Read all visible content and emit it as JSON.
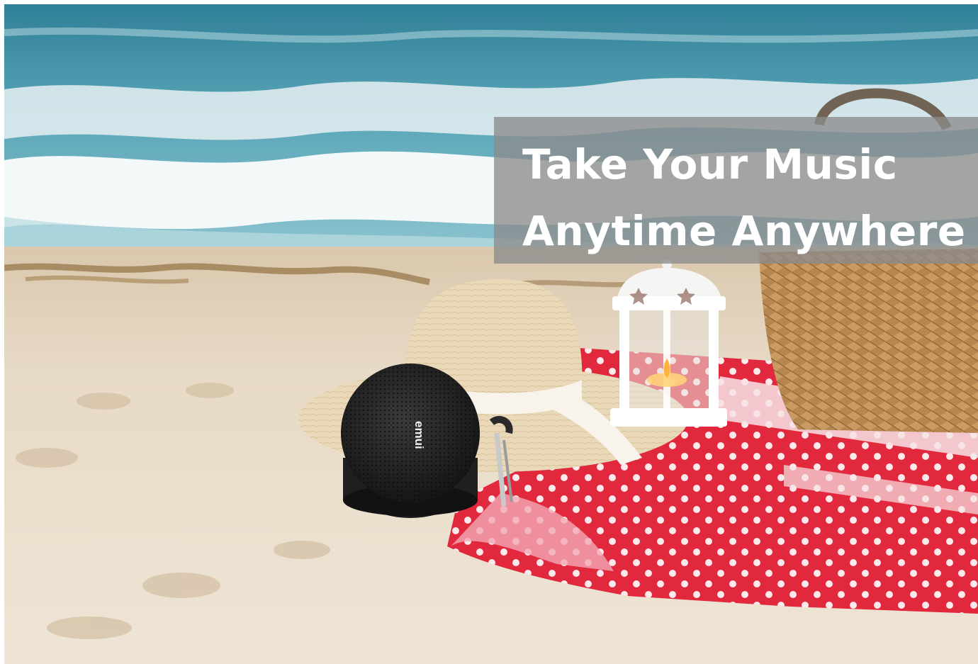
{
  "banner": {
    "line1": "Take Your Music",
    "line2": "Anytime Anywhere"
  },
  "product": {
    "brand_mark": "emui"
  },
  "colors": {
    "sea": "#3f8fa3",
    "foam": "#eef4f5",
    "sand": "#e7dac6",
    "blanket": "#e2283c",
    "straw": "#e8d7b5",
    "basket": "#b98a52",
    "speaker": "#232323",
    "banner_overlay": "#8c8c8c"
  }
}
